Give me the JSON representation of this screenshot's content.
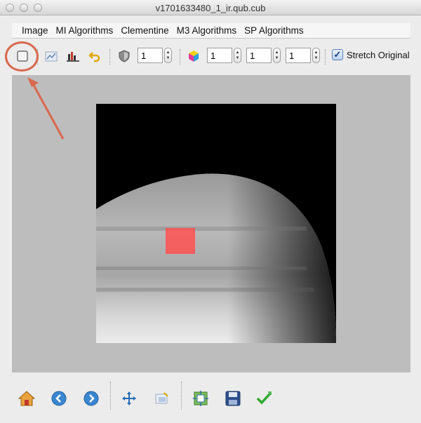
{
  "window": {
    "title": "v1701633480_1_ir.qub.cub"
  },
  "menu": [
    "Image",
    "MI Algorithms",
    "Clementine",
    "M3 Algorithms",
    "SP Algorithms"
  ],
  "toolbar": {
    "band_single": "1",
    "band_r": "1",
    "band_g": "1",
    "band_b": "1",
    "stretch_label": "Stretch Original",
    "stretch_checked": true
  },
  "colors": {
    "annotation": "#d9684e",
    "roi": "#ff5050",
    "viewport_bg": "#bdbdbd"
  }
}
